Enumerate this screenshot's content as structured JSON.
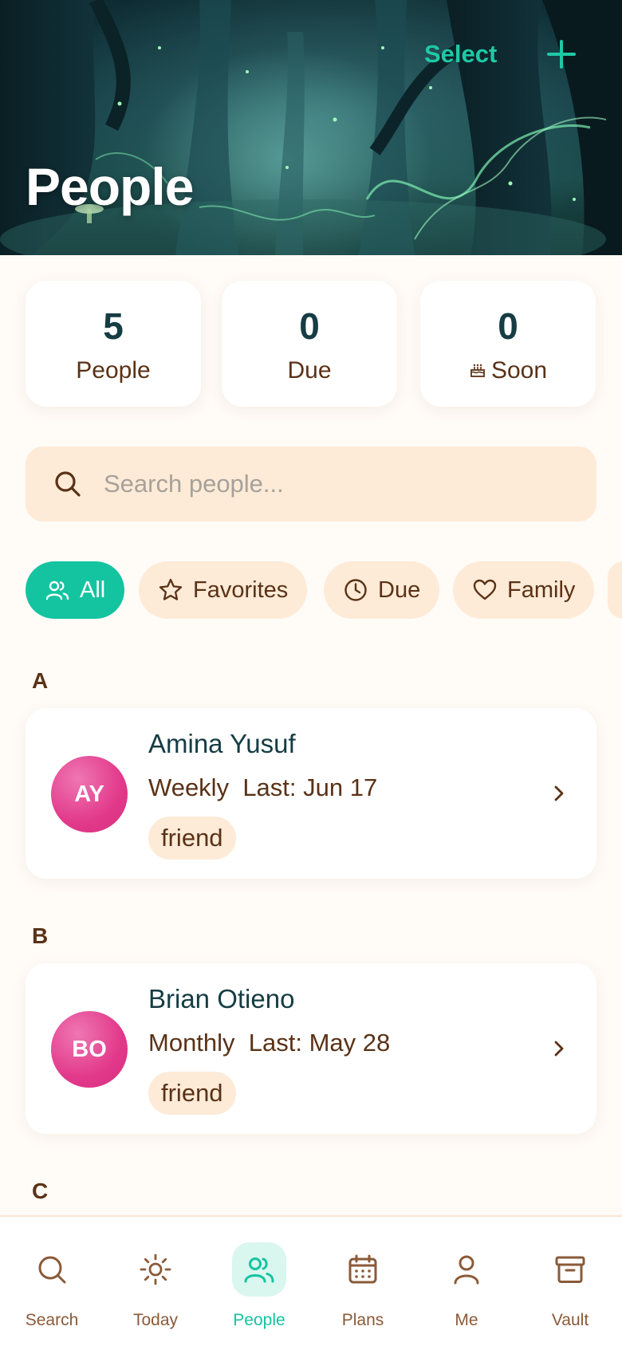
{
  "header": {
    "title": "People",
    "select_label": "Select",
    "add_icon": "plus-icon"
  },
  "stats": [
    {
      "value": "5",
      "label": "People"
    },
    {
      "value": "0",
      "label": "Due"
    },
    {
      "value": "0",
      "label": "Soon",
      "icon": "cake-icon"
    }
  ],
  "search": {
    "placeholder": "Search people...",
    "value": ""
  },
  "filters": [
    {
      "label": "All",
      "icon": "users-icon",
      "active": true
    },
    {
      "label": "Favorites",
      "icon": "star-icon"
    },
    {
      "label": "Due",
      "icon": "clock-icon"
    },
    {
      "label": "Family",
      "icon": "heart-icon"
    }
  ],
  "sections": [
    {
      "letter": "A",
      "people": [
        {
          "initials": "AY",
          "name": "Amina Yusuf",
          "frequency": "Weekly",
          "last": "Last: Jun 17",
          "tag": "friend"
        }
      ]
    },
    {
      "letter": "B",
      "people": [
        {
          "initials": "BO",
          "name": "Brian Otieno",
          "frequency": "Monthly",
          "last": "Last: May 28",
          "tag": "friend"
        }
      ]
    },
    {
      "letter": "C",
      "people": []
    }
  ],
  "nav": [
    {
      "label": "Search",
      "icon": "search-icon"
    },
    {
      "label": "Today",
      "icon": "sun-icon"
    },
    {
      "label": "People",
      "icon": "users-icon",
      "active": true
    },
    {
      "label": "Plans",
      "icon": "calendar-icon"
    },
    {
      "label": "Me",
      "icon": "user-icon"
    },
    {
      "label": "Vault",
      "icon": "archive-icon"
    }
  ],
  "colors": {
    "accent": "#14c4a0",
    "brown": "#5a3217",
    "dark_teal": "#163c44",
    "chip_bg": "#fdebd7",
    "avatar_pink": "#e2398b",
    "background": "#fffbf7"
  }
}
